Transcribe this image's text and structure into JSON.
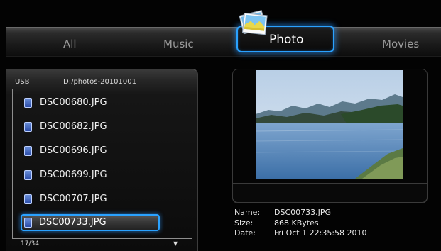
{
  "tabs": {
    "all": "All",
    "music": "Music",
    "photo": "Photo",
    "movies": "Movies",
    "active": "Photo"
  },
  "browser": {
    "source": "USB",
    "path": "D:/photos-20101001",
    "files": [
      "DSC00680.JPG",
      "DSC00682.JPG",
      "DSC00696.JPG",
      "DSC00699.JPG",
      "DSC00707.JPG",
      "DSC00733.JPG"
    ],
    "selected_file": "DSC00733.JPG",
    "counter": "17/34",
    "scroll_indicator": "▼"
  },
  "preview": {
    "labels": {
      "name": "Name:",
      "size": "Size:",
      "date": "Date:"
    },
    "values": {
      "name": "DSC00733.JPG",
      "size": "868 KBytes",
      "date": "Fri Oct  1 22:35:58 2010"
    }
  },
  "icons": {
    "tab_photo": "photo-stack-icon",
    "file": "image-file-icon"
  },
  "colors": {
    "accent": "#2aa2ff",
    "background": "#030303"
  }
}
